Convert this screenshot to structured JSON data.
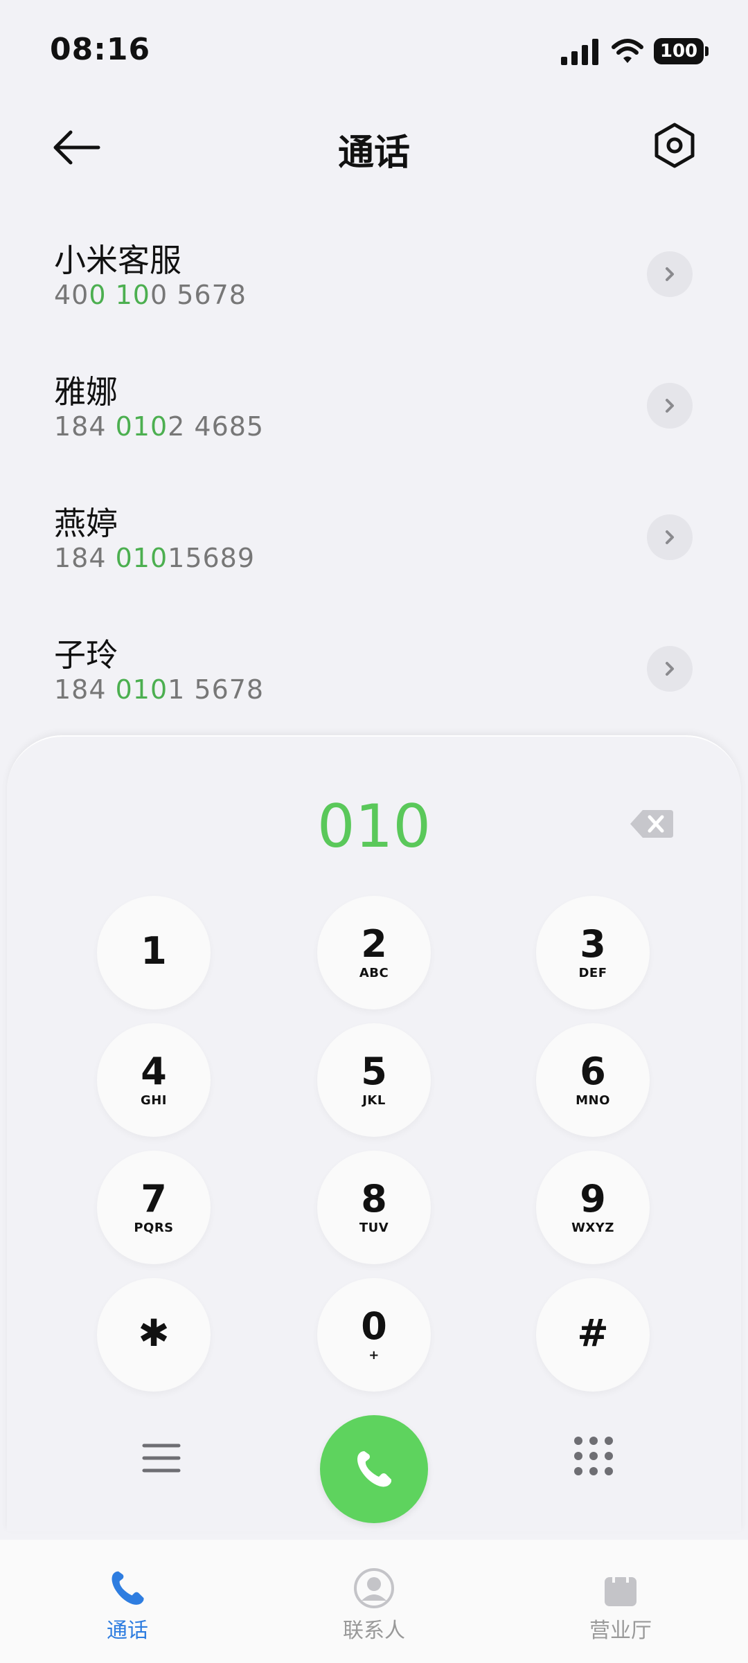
{
  "status_bar": {
    "time": "08:16",
    "battery": "100"
  },
  "header": {
    "title": "通话"
  },
  "contacts": [
    {
      "name": "小米客服",
      "number_parts": [
        "40",
        "0 10",
        "0 5678"
      ]
    },
    {
      "name": "雅娜",
      "number_parts": [
        "184 ",
        "010",
        "2 4685"
      ]
    },
    {
      "name": "燕婷",
      "number_parts": [
        "184 ",
        "010",
        "15689"
      ]
    },
    {
      "name": "子玲",
      "number_parts": [
        "184 ",
        "010",
        "1 5678"
      ]
    }
  ],
  "dialer": {
    "input": "010",
    "keys": [
      {
        "digit": "1",
        "letters": ""
      },
      {
        "digit": "2",
        "letters": "ABC"
      },
      {
        "digit": "3",
        "letters": "DEF"
      },
      {
        "digit": "4",
        "letters": "GHI"
      },
      {
        "digit": "5",
        "letters": "JKL"
      },
      {
        "digit": "6",
        "letters": "MNO"
      },
      {
        "digit": "7",
        "letters": "PQRS"
      },
      {
        "digit": "8",
        "letters": "TUV"
      },
      {
        "digit": "9",
        "letters": "WXYZ"
      },
      {
        "digit": "✱",
        "letters": ""
      },
      {
        "digit": "0",
        "letters": "+"
      },
      {
        "digit": "#",
        "letters": ""
      }
    ]
  },
  "bottom_nav": [
    {
      "label": "通话",
      "icon": "phone-icon",
      "active": true
    },
    {
      "label": "联系人",
      "icon": "person-icon",
      "active": false
    },
    {
      "label": "营业厅",
      "icon": "bag-icon",
      "active": false
    }
  ],
  "colors": {
    "highlight": "#4caf50",
    "call": "#5ed35e",
    "active_tab": "#2e7de0"
  }
}
